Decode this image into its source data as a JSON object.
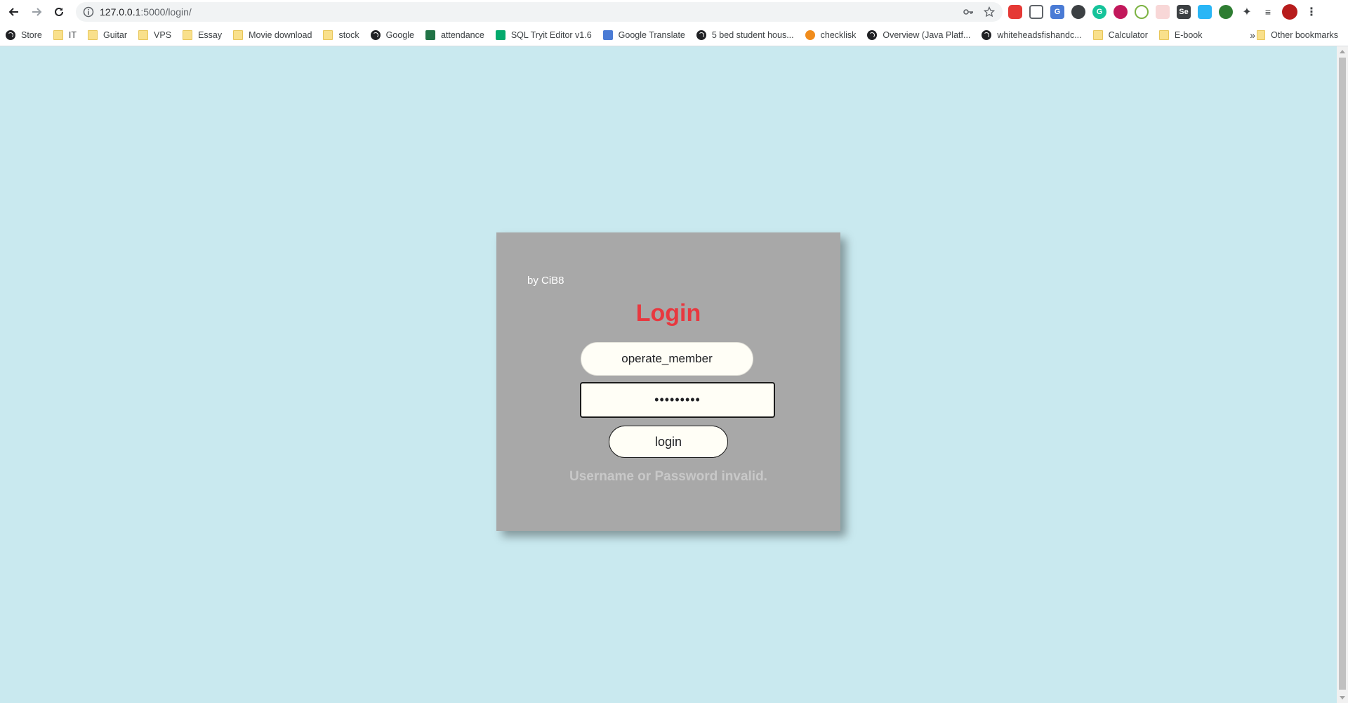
{
  "browser": {
    "url_host": "127.0.0.1",
    "url_path": ":5000/login/",
    "bookmarks": [
      {
        "label": "Store",
        "icon": "globe-icon"
      },
      {
        "label": "IT",
        "icon": "folder-icon"
      },
      {
        "label": "Guitar",
        "icon": "folder-icon"
      },
      {
        "label": "VPS",
        "icon": "folder-icon"
      },
      {
        "label": "Essay",
        "icon": "folder-icon"
      },
      {
        "label": "Movie download",
        "icon": "folder-icon"
      },
      {
        "label": "stock",
        "icon": "folder-icon"
      },
      {
        "label": "Google",
        "icon": "globe-icon"
      },
      {
        "label": "attendance",
        "icon": "forms-icon"
      },
      {
        "label": "SQL Tryit Editor v1.6",
        "icon": "w3-icon"
      },
      {
        "label": "Google Translate",
        "icon": "translate-icon"
      },
      {
        "label": "5 bed student hous...",
        "icon": "globe-icon"
      },
      {
        "label": "checklisk",
        "icon": "b-icon"
      },
      {
        "label": "Overview (Java Platf...",
        "icon": "globe-icon"
      },
      {
        "label": "whiteheadsfishandc...",
        "icon": "globe-icon"
      },
      {
        "label": "Calculator",
        "icon": "folder-icon"
      },
      {
        "label": "E-book",
        "icon": "folder-icon"
      }
    ],
    "more_label": "»",
    "other_bookmarks": "Other bookmarks"
  },
  "login": {
    "byline": "by CiB8",
    "title": "Login",
    "username_value": "operate_member",
    "password_value": "•••••••••",
    "button_label": "login",
    "error": "Username or Password invalid."
  },
  "colors": {
    "page_bg": "#c9e9ef",
    "card_bg": "#a8a8a8",
    "title": "#e8383f",
    "error": "#c8c8c8"
  }
}
